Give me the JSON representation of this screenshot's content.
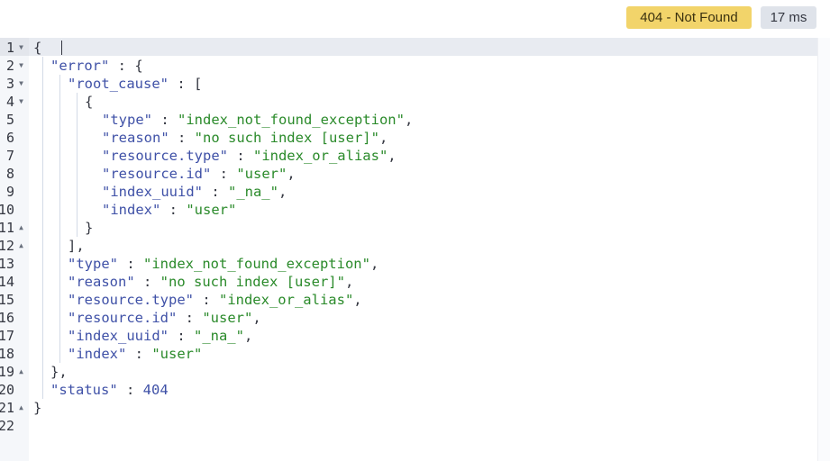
{
  "status_badge": {
    "label": "404 - Not Found",
    "color": "#f2d46a"
  },
  "time_badge": {
    "label": "17 ms"
  },
  "editor": {
    "lines": [
      {
        "num": "1",
        "fold": "down",
        "indent": 0,
        "tokens": [
          [
            "pun",
            "{"
          ]
        ]
      },
      {
        "num": "2",
        "fold": "down",
        "indent": 1,
        "tokens": [
          [
            "key",
            "\"error\""
          ],
          [
            "pun",
            " : {"
          ]
        ]
      },
      {
        "num": "3",
        "fold": "down",
        "indent": 2,
        "tokens": [
          [
            "key",
            "\"root_cause\""
          ],
          [
            "pun",
            " : ["
          ]
        ]
      },
      {
        "num": "4",
        "fold": "down",
        "indent": 3,
        "tokens": [
          [
            "pun",
            "{"
          ]
        ]
      },
      {
        "num": "5",
        "fold": "",
        "indent": 4,
        "tokens": [
          [
            "key",
            "\"type\""
          ],
          [
            "pun",
            " : "
          ],
          [
            "str",
            "\"index_not_found_exception\""
          ],
          [
            "pun",
            ","
          ]
        ]
      },
      {
        "num": "6",
        "fold": "",
        "indent": 4,
        "tokens": [
          [
            "key",
            "\"reason\""
          ],
          [
            "pun",
            " : "
          ],
          [
            "str",
            "\"no such index [user]\""
          ],
          [
            "pun",
            ","
          ]
        ]
      },
      {
        "num": "7",
        "fold": "",
        "indent": 4,
        "tokens": [
          [
            "key",
            "\"resource.type\""
          ],
          [
            "pun",
            " : "
          ],
          [
            "str",
            "\"index_or_alias\""
          ],
          [
            "pun",
            ","
          ]
        ]
      },
      {
        "num": "8",
        "fold": "",
        "indent": 4,
        "tokens": [
          [
            "key",
            "\"resource.id\""
          ],
          [
            "pun",
            " : "
          ],
          [
            "str",
            "\"user\""
          ],
          [
            "pun",
            ","
          ]
        ]
      },
      {
        "num": "9",
        "fold": "",
        "indent": 4,
        "tokens": [
          [
            "key",
            "\"index_uuid\""
          ],
          [
            "pun",
            " : "
          ],
          [
            "str",
            "\"_na_\""
          ],
          [
            "pun",
            ","
          ]
        ]
      },
      {
        "num": "10",
        "fold": "",
        "indent": 4,
        "tokens": [
          [
            "key",
            "\"index\""
          ],
          [
            "pun",
            " : "
          ],
          [
            "str",
            "\"user\""
          ]
        ]
      },
      {
        "num": "11",
        "fold": "up",
        "indent": 3,
        "tokens": [
          [
            "pun",
            "}"
          ]
        ]
      },
      {
        "num": "12",
        "fold": "up",
        "indent": 2,
        "tokens": [
          [
            "pun",
            "],"
          ]
        ]
      },
      {
        "num": "13",
        "fold": "",
        "indent": 2,
        "tokens": [
          [
            "key",
            "\"type\""
          ],
          [
            "pun",
            " : "
          ],
          [
            "str",
            "\"index_not_found_exception\""
          ],
          [
            "pun",
            ","
          ]
        ]
      },
      {
        "num": "14",
        "fold": "",
        "indent": 2,
        "tokens": [
          [
            "key",
            "\"reason\""
          ],
          [
            "pun",
            " : "
          ],
          [
            "str",
            "\"no such index [user]\""
          ],
          [
            "pun",
            ","
          ]
        ]
      },
      {
        "num": "15",
        "fold": "",
        "indent": 2,
        "tokens": [
          [
            "key",
            "\"resource.type\""
          ],
          [
            "pun",
            " : "
          ],
          [
            "str",
            "\"index_or_alias\""
          ],
          [
            "pun",
            ","
          ]
        ]
      },
      {
        "num": "16",
        "fold": "",
        "indent": 2,
        "tokens": [
          [
            "key",
            "\"resource.id\""
          ],
          [
            "pun",
            " : "
          ],
          [
            "str",
            "\"user\""
          ],
          [
            "pun",
            ","
          ]
        ]
      },
      {
        "num": "17",
        "fold": "",
        "indent": 2,
        "tokens": [
          [
            "key",
            "\"index_uuid\""
          ],
          [
            "pun",
            " : "
          ],
          [
            "str",
            "\"_na_\""
          ],
          [
            "pun",
            ","
          ]
        ]
      },
      {
        "num": "18",
        "fold": "",
        "indent": 2,
        "tokens": [
          [
            "key",
            "\"index\""
          ],
          [
            "pun",
            " : "
          ],
          [
            "str",
            "\"user\""
          ]
        ]
      },
      {
        "num": "19",
        "fold": "up",
        "indent": 1,
        "tokens": [
          [
            "pun",
            "},"
          ]
        ]
      },
      {
        "num": "20",
        "fold": "",
        "indent": 1,
        "tokens": [
          [
            "key",
            "\"status\""
          ],
          [
            "pun",
            " : "
          ],
          [
            "num",
            "404"
          ]
        ]
      },
      {
        "num": "21",
        "fold": "up",
        "indent": 0,
        "tokens": [
          [
            "pun",
            "}"
          ]
        ]
      },
      {
        "num": "22",
        "fold": "",
        "indent": 0,
        "tokens": []
      }
    ]
  }
}
